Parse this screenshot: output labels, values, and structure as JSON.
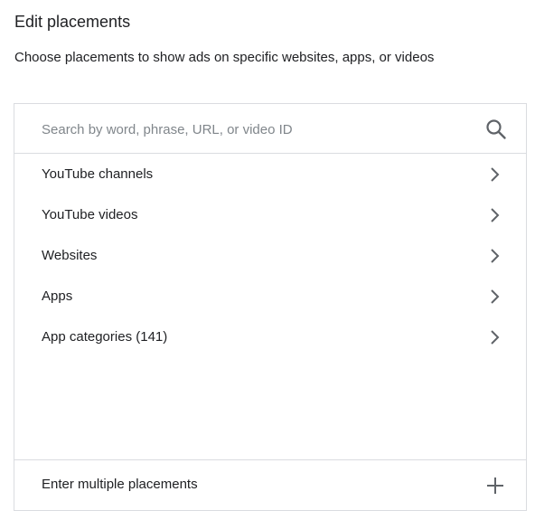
{
  "header": {
    "title": "Edit placements",
    "subtitle": "Choose placements to show ads on specific websites, apps, or videos"
  },
  "search": {
    "placeholder": "Search by word, phrase, URL, or video ID",
    "value": "",
    "icon": "search-icon"
  },
  "categories": [
    {
      "label": "YouTube channels",
      "icon": "chevron-right-icon"
    },
    {
      "label": "YouTube videos",
      "icon": "chevron-right-icon"
    },
    {
      "label": "Websites",
      "icon": "chevron-right-icon"
    },
    {
      "label": "Apps",
      "icon": "chevron-right-icon"
    },
    {
      "label": "App categories (141)",
      "icon": "chevron-right-icon"
    }
  ],
  "footer": {
    "label": "Enter multiple placements",
    "icon": "plus-icon"
  },
  "colors": {
    "text": "#202124",
    "placeholder": "#80868b",
    "icon": "#5f6368",
    "border": "#dadce0"
  }
}
